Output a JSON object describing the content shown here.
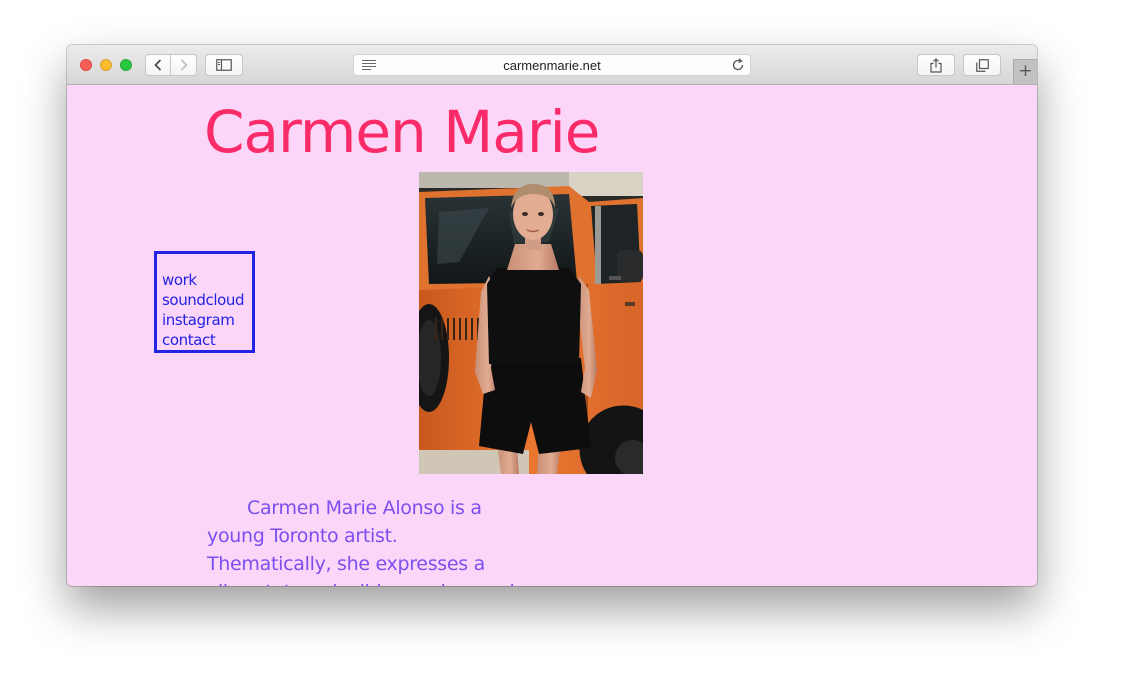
{
  "browser": {
    "url": "carmenmarie.net"
  },
  "site": {
    "title": "Carmen Marie",
    "nav": [
      "work",
      "soundcloud",
      "instagram",
      "contact"
    ],
    "bio": "Carmen Marie Alonso is a young Toronto artist. Thematically, she expresses a vibrant, travel, vibing and surreal"
  },
  "colors": {
    "background": "#fcd6f8",
    "title": "#fb2b69",
    "nav": "#2323e6",
    "bio": "#7a4ff0"
  },
  "icons": {
    "back": "chevron-left-icon",
    "forward": "chevron-right-icon",
    "sidebar": "sidebar-icon",
    "reader": "reader-lines-icon",
    "reload": "reload-icon",
    "share": "share-icon",
    "tabs": "tabs-overview-icon",
    "new_tab": "plus-icon"
  }
}
